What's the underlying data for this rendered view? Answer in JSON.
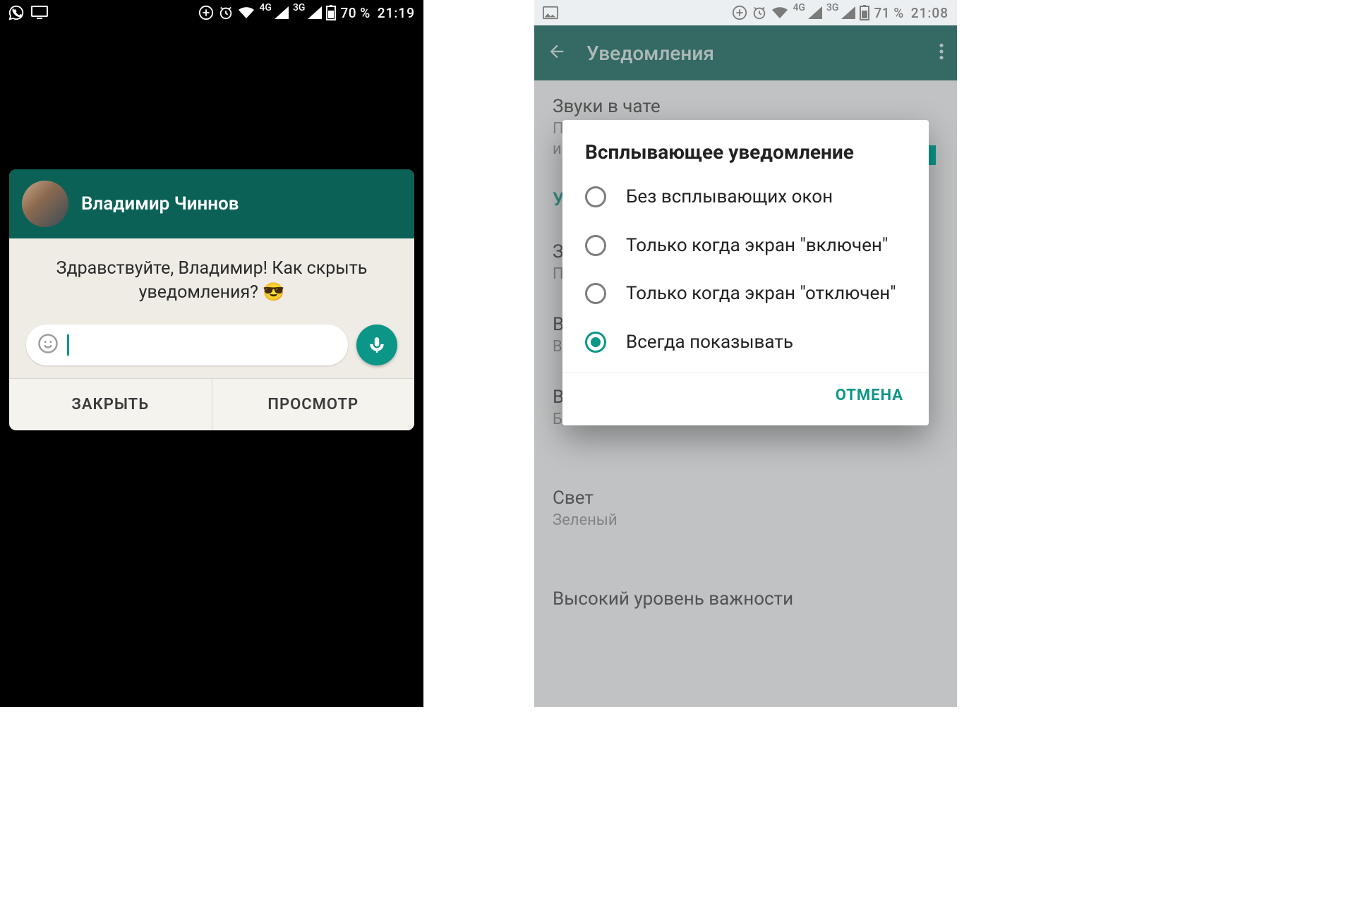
{
  "left": {
    "status": {
      "battery_pct": "70 %",
      "time": "21:19",
      "net1": "4G",
      "net2": "3G"
    },
    "popup": {
      "name": "Владимир Чиннов",
      "message": "Здравствуйте, Владимир! Как скрыть уведомления? 😎",
      "close_label": "ЗАКРЫТЬ",
      "view_label": "ПРОСМОТР"
    }
  },
  "right": {
    "status": {
      "battery_pct": "71 %",
      "time": "21:08",
      "net1": "4G",
      "net2": "3G"
    },
    "appbar_title": "Уведомления",
    "bg": {
      "row1_title": "Звуки в чате",
      "row1_sub_a": "П",
      "row1_sub_b": "и",
      "row2_a": "У",
      "row3_a": "З",
      "row3_b": "П",
      "row4_a": "В",
      "row4_b": "В",
      "row5_a": "В",
      "row5_b": "Б",
      "light_title": "Свет",
      "light_value": "Зеленый",
      "bottom_partial": "Высокий уровень важности"
    },
    "dialog": {
      "title": "Всплывающее уведомление",
      "options": [
        "Без всплывающих окон",
        "Только когда экран \"включен\"",
        "Только когда экран \"отключен\"",
        "Всегда показывать"
      ],
      "selected_index": 3,
      "cancel_label": "ОТМЕНА"
    }
  }
}
